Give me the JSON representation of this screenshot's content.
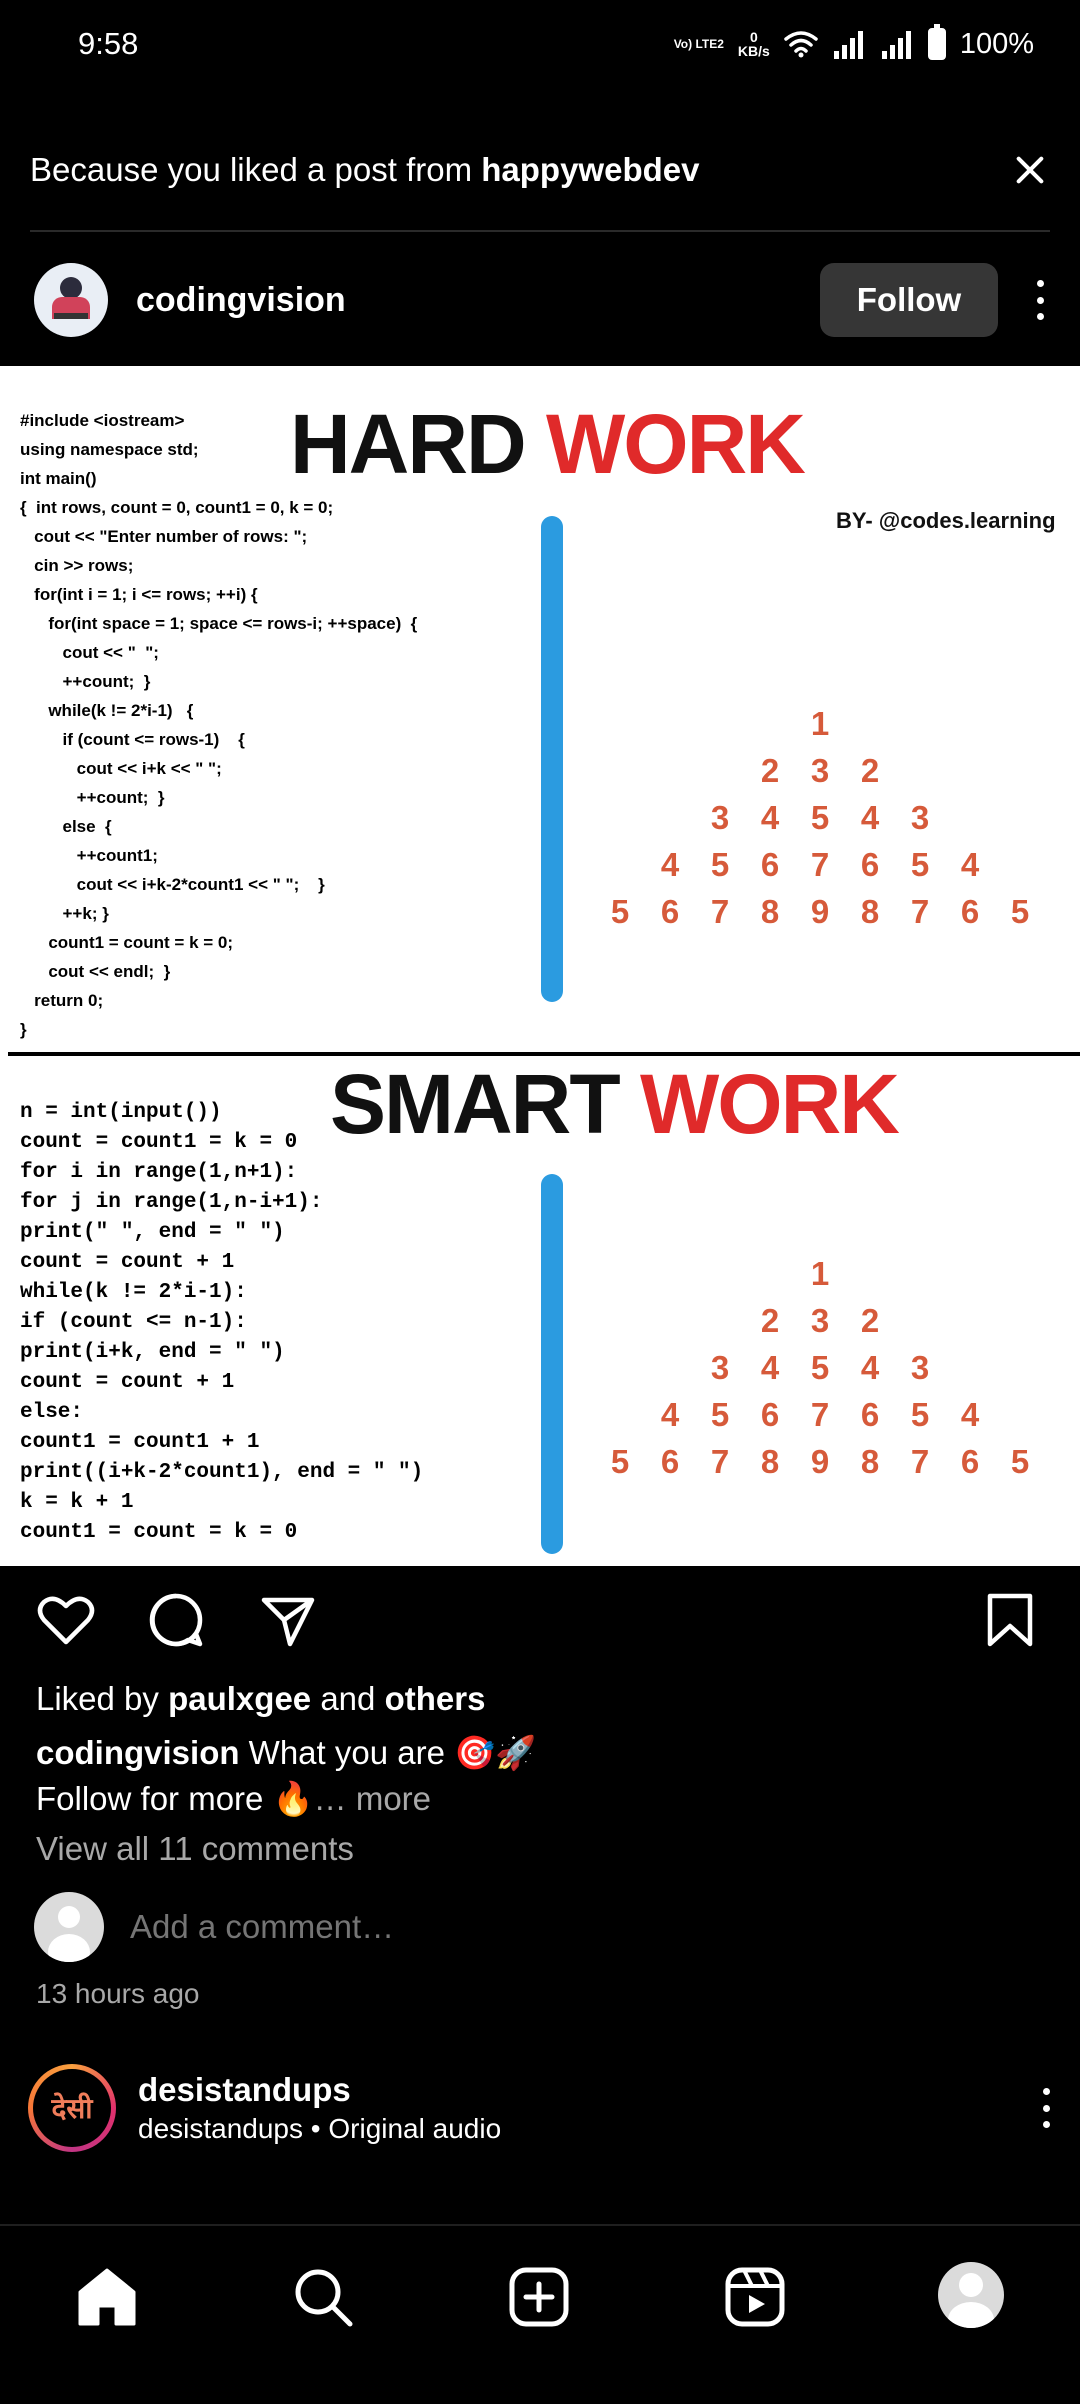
{
  "status_bar": {
    "time": "9:58",
    "network_label": "Vo) LTE2",
    "speed_value": "0",
    "speed_unit": "KB/s",
    "battery": "100%"
  },
  "suggestion": {
    "prefix": "Because you liked a post from ",
    "account": "happywebdev"
  },
  "post": {
    "username": "codingvision",
    "follow_label": "Follow",
    "image": {
      "hard_title_1": "HARD",
      "hard_title_2": "WORK",
      "smart_title_1": "SMART",
      "smart_title_2": "WORK",
      "byline": "BY- @codes.learning",
      "hard_code": [
        "#include <iostream>",
        "using namespace std;",
        "int main()",
        "{  int rows, count = 0, count1 = 0, k = 0;",
        "   cout << \"Enter number of rows: \";",
        "   cin >> rows;",
        "   for(int i = 1; i <= rows; ++i) {",
        "      for(int space = 1; space <= rows-i; ++space)  {",
        "         cout << \"  \";",
        "         ++count;  }",
        "      while(k != 2*i-1)   {",
        "         if (count <= rows-1)    {",
        "            cout << i+k << \" \";",
        "            ++count;  }",
        "         else  {",
        "            ++count1;",
        "            cout << i+k-2*count1 << \" \";    }",
        "         ++k; }",
        "      count1 = count = k = 0;",
        "      cout << endl;  }",
        "   return 0;",
        "}"
      ],
      "smart_code": [
        "n = int(input())",
        "count = count1 = k = 0",
        "for i in range(1,n+1):",
        "for j in range(1,n-i+1):",
        "print(\" \", end = \" \")",
        "count = count + 1",
        "while(k != 2*i-1):",
        "if (count <= n-1):",
        "print(i+k, end = \" \")",
        "count = count + 1",
        "else:",
        "count1 = count1 + 1",
        "print((i+k-2*count1), end = \" \")",
        "k = k + 1",
        "count1 = count = k = 0"
      ],
      "pyramid": [
        [
          "1"
        ],
        [
          "2",
          "3",
          "2"
        ],
        [
          "3",
          "4",
          "5",
          "4",
          "3"
        ],
        [
          "4",
          "5",
          "6",
          "7",
          "6",
          "5",
          "4"
        ],
        [
          "5",
          "6",
          "7",
          "8",
          "9",
          "8",
          "7",
          "6",
          "5"
        ]
      ]
    },
    "likes": {
      "prefix": "Liked by ",
      "user": "paulxgee",
      "middle": " and ",
      "others": "others"
    },
    "caption": {
      "user": "codingvision",
      "text": " What you are 🎯🚀",
      "line2": "Follow for more 🔥",
      "more": "… more"
    },
    "view_comments": "View all 11 comments",
    "add_comment_placeholder": "Add a comment…",
    "timestamp": "13 hours ago"
  },
  "next_post": {
    "avatar_text": "देसी",
    "username": "desistandups",
    "subtitle": "desistandups • Original audio"
  },
  "icons": {
    "like": "heart-icon",
    "comment": "comment-icon",
    "share": "share-icon",
    "save": "bookmark-icon",
    "home": "home-icon",
    "search": "search-icon",
    "create": "create-icon",
    "reels": "reels-icon"
  }
}
